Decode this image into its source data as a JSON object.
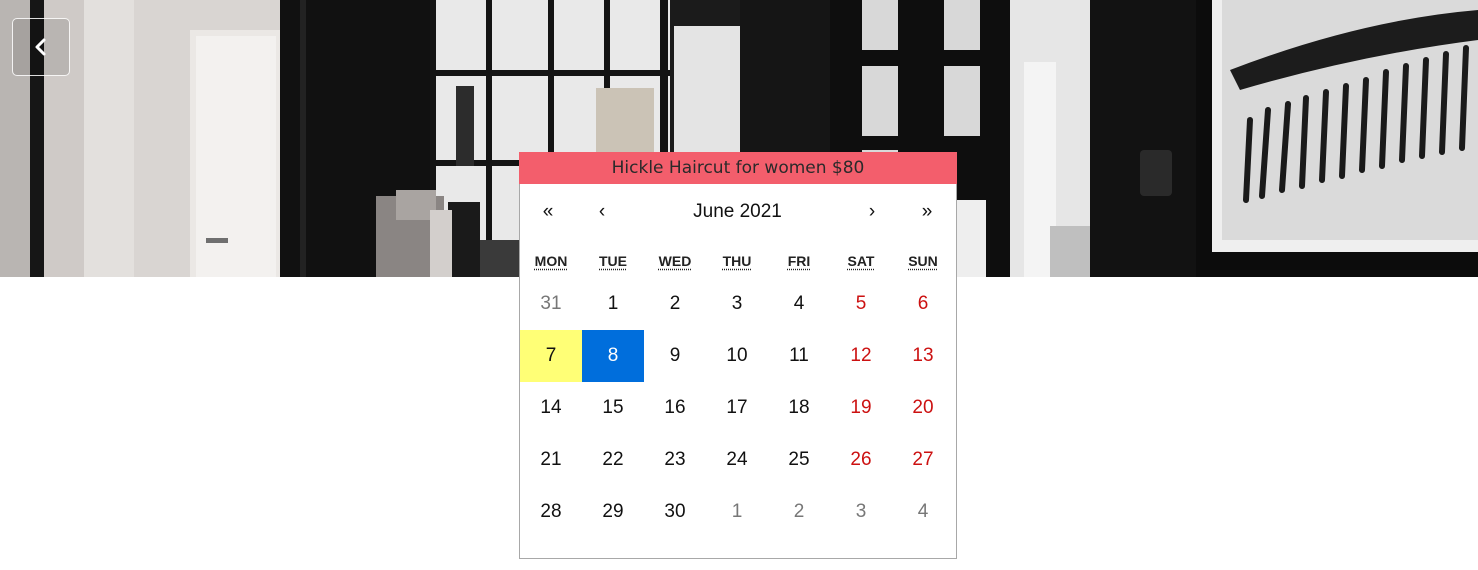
{
  "hero": {
    "back_icon": "chevron-left-icon"
  },
  "calendar": {
    "title": "Hickle Haircut for women $80",
    "nav": {
      "prev_year": "«",
      "prev_month": "‹",
      "month_label": "June 2021",
      "next_month": "›",
      "next_year": "»"
    },
    "weekdays": [
      {
        "abbr": "MON"
      },
      {
        "abbr": "TUE"
      },
      {
        "abbr": "WED"
      },
      {
        "abbr": "THU"
      },
      {
        "abbr": "FRI"
      },
      {
        "abbr": "SAT"
      },
      {
        "abbr": "SUN"
      }
    ],
    "weeks": [
      [
        "31",
        "1",
        "2",
        "3",
        "4",
        "5",
        "6"
      ],
      [
        "7",
        "8",
        "9",
        "10",
        "11",
        "12",
        "13"
      ],
      [
        "14",
        "15",
        "16",
        "17",
        "18",
        "19",
        "20"
      ],
      [
        "21",
        "22",
        "23",
        "24",
        "25",
        "26",
        "27"
      ],
      [
        "28",
        "29",
        "30",
        "1",
        "2",
        "3",
        "4"
      ]
    ],
    "today": "7",
    "selected": "8",
    "colors": {
      "title_bg": "#f35e6c",
      "today_bg": "#ffff76",
      "selected_bg": "#006edc",
      "weekend_text": "#cc1111",
      "neighbor_text": "#777777"
    }
  }
}
